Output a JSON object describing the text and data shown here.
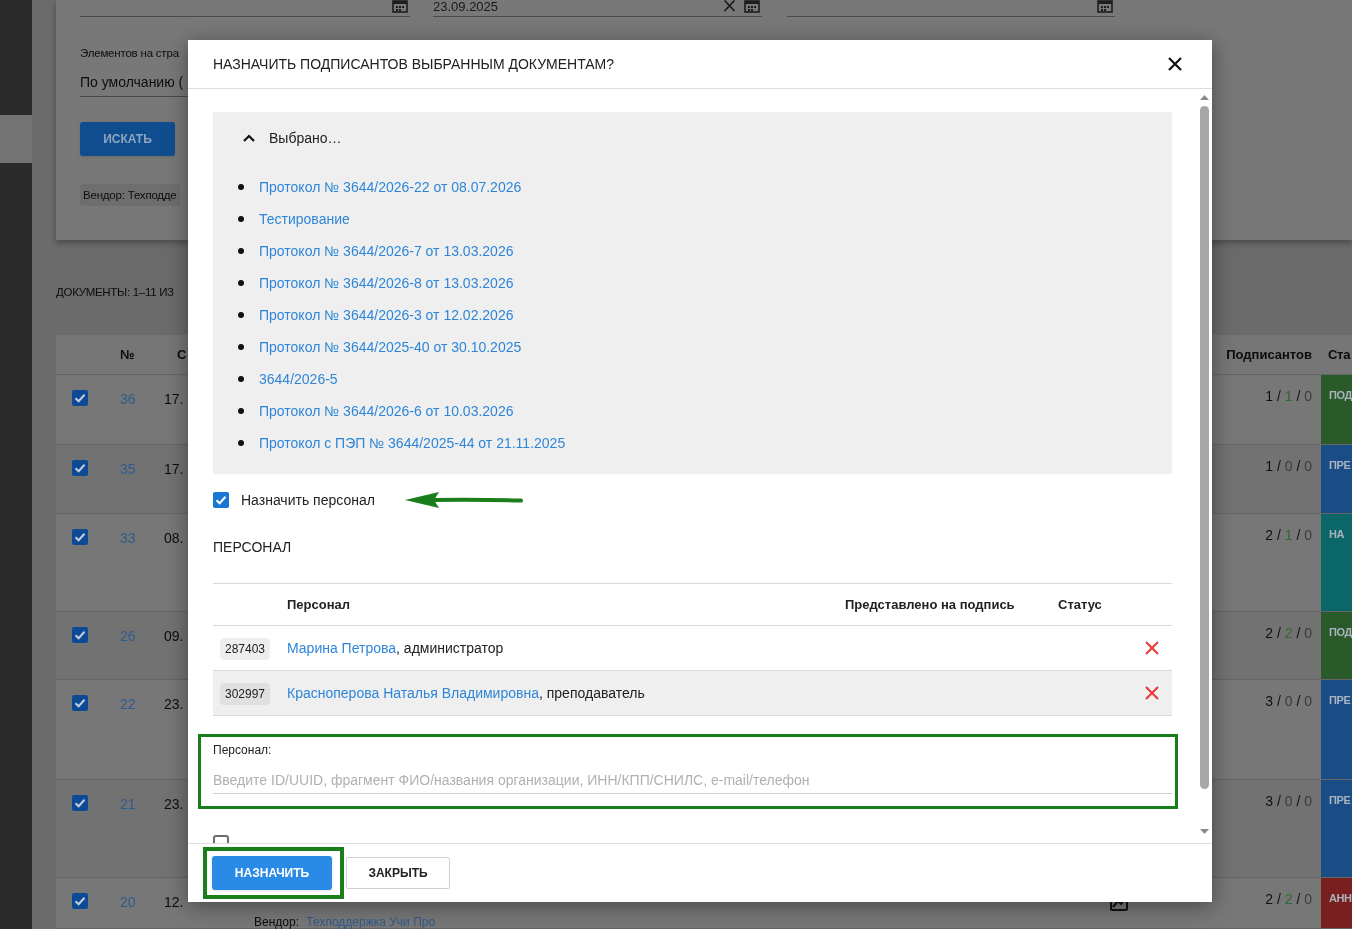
{
  "page": {
    "date_fields": [
      {
        "clearable": false
      },
      {
        "value": "23.09.2025",
        "clearable": true
      },
      {
        "clearable": false
      }
    ],
    "per_page": {
      "label": "Элементов на стра",
      "value": "По умолчанию ("
    },
    "search_button": "ИСКАТЬ",
    "filter_chip": "Вендор: Техподде",
    "documents_heading": "ДОКУМЕНТЫ: 1–11 ИЗ",
    "table": {
      "columns": [
        "№",
        "С"
      ],
      "right_columns": [
        "Подписантов",
        "Ста"
      ],
      "rows": [
        {
          "checked": true,
          "number": "36",
          "date": "17.",
          "signers": [
            {
              "text": "1",
              "color": "#111111"
            },
            {
              "text": "/",
              "color": "#111111"
            },
            {
              "text": "1",
              "color": "#2d6a2d"
            },
            {
              "text": "/",
              "color": "#111111"
            },
            {
              "text": "0",
              "color": "#3c3c3c"
            }
          ],
          "status": {
            "text": "ПОД",
            "color": "#2a5a2a"
          }
        },
        {
          "checked": true,
          "number": "35",
          "date": "17.",
          "signers": [
            {
              "text": "1",
              "color": "#111111"
            },
            {
              "text": "/",
              "color": "#111111"
            },
            {
              "text": "0",
              "color": "#3c3c3c"
            },
            {
              "text": "/",
              "color": "#111111"
            },
            {
              "text": "0",
              "color": "#3c3c3c"
            }
          ],
          "status": {
            "text": "ПРЕ",
            "color": "#1a4c85"
          }
        },
        {
          "checked": true,
          "number": "33",
          "date": "08.",
          "signers": [
            {
              "text": "2",
              "color": "#111111"
            },
            {
              "text": "/",
              "color": "#111111"
            },
            {
              "text": "1",
              "color": "#2d6a2d"
            },
            {
              "text": "/",
              "color": "#111111"
            },
            {
              "text": "0",
              "color": "#3c3c3c"
            }
          ],
          "status": {
            "text": "НА",
            "color": "#0b6767"
          }
        },
        {
          "checked": true,
          "number": "26",
          "date": "09.",
          "signers": [
            {
              "text": "2",
              "color": "#111111"
            },
            {
              "text": "/",
              "color": "#111111"
            },
            {
              "text": "2",
              "color": "#2d6a2d"
            },
            {
              "text": "/",
              "color": "#111111"
            },
            {
              "text": "0",
              "color": "#3c3c3c"
            }
          ],
          "status": {
            "text": "ПОД",
            "color": "#2a5a2a"
          }
        },
        {
          "checked": true,
          "number": "22",
          "date": "23.",
          "signers": [
            {
              "text": "3",
              "color": "#111111"
            },
            {
              "text": "/",
              "color": "#111111"
            },
            {
              "text": "0",
              "color": "#3c3c3c"
            },
            {
              "text": "/",
              "color": "#111111"
            },
            {
              "text": "0",
              "color": "#3c3c3c"
            }
          ],
          "status": {
            "text": "ПРЕ",
            "color": "#1a4c85"
          }
        },
        {
          "checked": true,
          "number": "21",
          "date": "23.",
          "signers": [
            {
              "text": "3",
              "color": "#111111"
            },
            {
              "text": "/",
              "color": "#111111"
            },
            {
              "text": "0",
              "color": "#3c3c3c"
            },
            {
              "text": "/",
              "color": "#111111"
            },
            {
              "text": "0",
              "color": "#3c3c3c"
            }
          ],
          "status": {
            "text": "ПРЕ",
            "color": "#1a4c85"
          }
        },
        {
          "checked": true,
          "number": "20",
          "date": "12.",
          "vendor_label": "Вендор:",
          "vendor": "Техподдержка Учи Про",
          "attachment": true,
          "signers": [
            {
              "text": "2",
              "color": "#111111"
            },
            {
              "text": "/",
              "color": "#111111"
            },
            {
              "text": "2",
              "color": "#2d6a2d"
            },
            {
              "text": "/",
              "color": "#111111"
            },
            {
              "text": "0",
              "color": "#3c3c3c"
            }
          ],
          "status": {
            "text": "АНН",
            "color": "#7a1f1f"
          }
        }
      ]
    }
  },
  "dialog": {
    "title": "НАЗНАЧИТЬ ПОДПИСАНТОВ ВЫБРАННЫМ ДОКУМЕНТАМ?",
    "selected_documents": {
      "title": "Выбрано…",
      "expanded": true,
      "items": [
        "Протокол № 3644/2026-22 от 08.07.2026",
        "Тестирование",
        "Протокол № 3644/2026-7 от 13.03.2026",
        "Протокол № 3644/2026-8 от 13.03.2026",
        "Протокол № 3644/2026-3 от 12.02.2026",
        "Протокол № 3644/2025-40 от 30.10.2025",
        "3644/2026-5",
        "Протокол № 3644/2026-6 от 10.03.2026",
        "Протокол с ПЭП № 3644/2025-44 от 21.11.2025"
      ]
    },
    "assign_staff": {
      "label": "Назначить персонал",
      "checked": true,
      "pointed_at": true
    },
    "staff_section": {
      "title": "ПЕРСОНАЛ",
      "columns": [
        "Персонал",
        "Представлено на подпись",
        "Статус"
      ],
      "rows": [
        {
          "id": "287403",
          "name": "Марина Петрова",
          "role": ", администратор"
        },
        {
          "id": "302997",
          "name": "Красноперова Наталья Владимировна",
          "role": ", преподаватель"
        }
      ]
    },
    "staff_field": {
      "label": "Персонал:",
      "placeholder": "Введите ID/UUID, фрагмент ФИО/названия организации, ИНН/КПП/СНИЛС, e-mail/телефон",
      "highlighted": true
    },
    "second_option": {
      "checked": false
    },
    "buttons": [
      {
        "label": "НАЗНАЧИТЬ",
        "kind": "primary",
        "highlighted": true
      },
      {
        "label": "ЗАКРЫТЬ",
        "kind": "secondary",
        "highlighted": false
      }
    ]
  }
}
